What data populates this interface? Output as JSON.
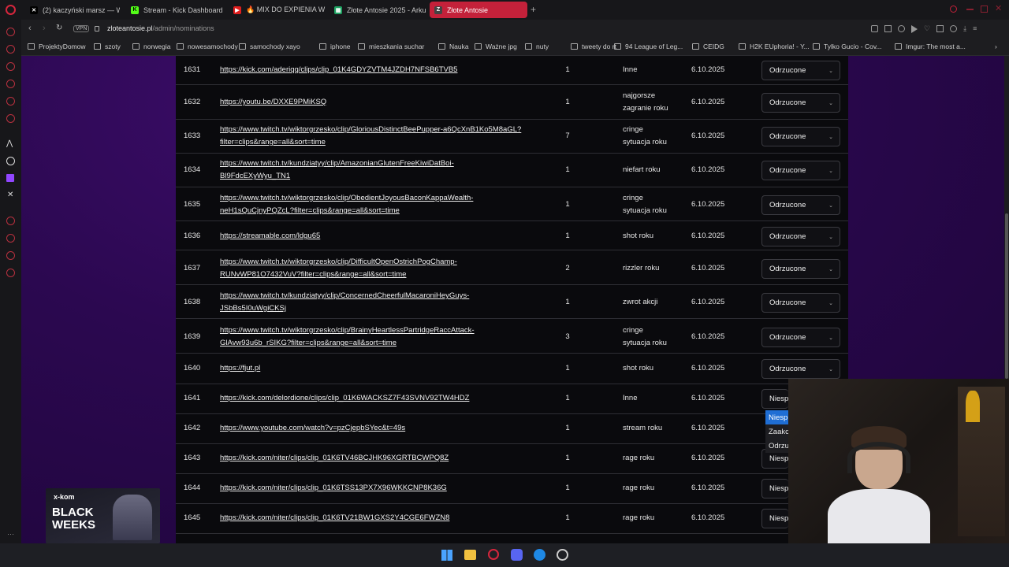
{
  "tabs": [
    {
      "icon": "x-icon",
      "label": "(2) kaczyński marsz — W"
    },
    {
      "icon": "kick-icon",
      "label": "Stream - Kick Dashboard"
    },
    {
      "icon": "youtube-icon",
      "label": "🔥 MIX DO EXPIENIA W"
    },
    {
      "icon": "sheets-icon",
      "label": "Złote Antosie 2025 - Arku"
    },
    {
      "icon": "site-icon",
      "label": "Złote Antosie"
    }
  ],
  "address": {
    "domain": "zloteantosie.pl",
    "path": "/admin/nominations",
    "vpn_label": "VPN"
  },
  "bookmarks": [
    "ProjektyDomow",
    "szoty",
    "norwegia",
    "nowesamochody",
    "samochody xayo",
    "iphone",
    "mieszkania suchar",
    "Nauka",
    "Ważne jpg",
    "nuty",
    "tweety do rt",
    "94 League of Leg...",
    "CEIDG",
    "H2K EUphoria! - Y...",
    "Tylko Gucio - Cov...",
    "Imgur: The most a..."
  ],
  "rows": [
    {
      "id": "1631",
      "url": [
        "https://kick.com/aderiqq/clips/clip_01K4GDYZVTM4JZDH7NFSB6TVB5"
      ],
      "votes": "1",
      "category": [
        "Inne"
      ],
      "date": "6.10.2025",
      "status": "Odrzucone"
    },
    {
      "id": "1632",
      "url": [
        "https://youtu.be/DXXE9PMiKSQ"
      ],
      "votes": "1",
      "category": [
        "najgorsze",
        "zagranie roku"
      ],
      "date": "6.10.2025",
      "status": "Odrzucone"
    },
    {
      "id": "1633",
      "url": [
        "https://www.twitch.tv/wiktorgrzesko/clip/GloriousDistinctBeePupper-a6QcXnB1Ko5M8aGL?",
        "filter=clips&range=all&sort=time"
      ],
      "votes": "7",
      "category": [
        "cringe",
        "sytuacja roku"
      ],
      "date": "6.10.2025",
      "status": "Odrzucone"
    },
    {
      "id": "1634",
      "url": [
        "https://www.twitch.tv/kundziatyy/clip/AmazonianGlutenFreeKiwiDatBoi-",
        "Bl9FdcEXyWyu_TN1"
      ],
      "votes": "1",
      "category": [
        "niefart roku"
      ],
      "date": "6.10.2025",
      "status": "Odrzucone"
    },
    {
      "id": "1635",
      "url": [
        "https://www.twitch.tv/wiktorgrzesko/clip/ObedientJoyousBaconKappaWealth-",
        "neH1sQuCjnyPQZcL?filter=clips&range=all&sort=time"
      ],
      "votes": "1",
      "category": [
        "cringe",
        "sytuacja roku"
      ],
      "date": "6.10.2025",
      "status": "Odrzucone"
    },
    {
      "id": "1636",
      "url": [
        "https://streamable.com/ldgu65"
      ],
      "votes": "1",
      "category": [
        "shot roku"
      ],
      "date": "6.10.2025",
      "status": "Odrzucone"
    },
    {
      "id": "1637",
      "url": [
        "https://www.twitch.tv/wiktorgrzesko/clip/DifficultOpenOstrichPogChamp-",
        "RUNvWP81O7432VuV?filter=clips&range=all&sort=time"
      ],
      "votes": "2",
      "category": [
        "rizzler roku"
      ],
      "date": "6.10.2025",
      "status": "Odrzucone"
    },
    {
      "id": "1638",
      "url": [
        "https://www.twitch.tv/kundziatyy/clip/ConcernedCheerfulMacaroniHeyGuys-",
        "JSbBs5I0uWgiCKSj"
      ],
      "votes": "1",
      "category": [
        "zwrot akcji"
      ],
      "date": "6.10.2025",
      "status": "Odrzucone"
    },
    {
      "id": "1639",
      "url": [
        "https://www.twitch.tv/wiktorgrzesko/clip/BrainyHeartlessPartridgeRaccAttack-",
        "GlAvw93u6b_rSIKG?filter=clips&range=all&sort=time"
      ],
      "votes": "3",
      "category": [
        "cringe",
        "sytuacja roku"
      ],
      "date": "6.10.2025",
      "status": "Odrzucone"
    },
    {
      "id": "1640",
      "url": [
        "https://fjut.pl"
      ],
      "votes": "1",
      "category": [
        "shot roku"
      ],
      "date": "6.10.2025",
      "status": "Odrzucone"
    },
    {
      "id": "1641",
      "url": [
        "https://kick.com/delordione/clips/clip_01K6WACKSZ7F43SVNV92TW4HDZ"
      ],
      "votes": "1",
      "category": [
        "Inne"
      ],
      "date": "6.10.2025",
      "status": "Niesp"
    },
    {
      "id": "1642",
      "url": [
        "https://www.youtube.com/watch?v=pzCjepbSYec&t=49s"
      ],
      "votes": "1",
      "category": [
        "stream roku"
      ],
      "date": "6.10.2025",
      "status": ""
    },
    {
      "id": "1643",
      "url": [
        "https://kick.com/niter/clips/clip_01K6TV46BCJHK96XGRTBCWPQ8Z"
      ],
      "votes": "1",
      "category": [
        "rage roku"
      ],
      "date": "6.10.2025",
      "status": "Niesp"
    },
    {
      "id": "1644",
      "url": [
        "https://kick.com/niter/clips/clip_01K6TSS13PX7X96WKKCNP8K36G"
      ],
      "votes": "1",
      "category": [
        "rage roku"
      ],
      "date": "6.10.2025",
      "status": "Niesp"
    },
    {
      "id": "1645",
      "url": [
        "https://kick.com/niter/clips/clip_01K6TV21BW1GXS2Y4CGE6FWZN8"
      ],
      "votes": "1",
      "category": [
        "rage roku"
      ],
      "date": "6.10.2025",
      "status": "Niesp"
    }
  ],
  "dropdown_options": [
    "Niesp",
    "Zaakc",
    "Odrzu"
  ],
  "ad": {
    "brand": "x-kom",
    "headline_1": "BLACK",
    "headline_2": "WEEKS"
  },
  "colors": {
    "accent": "#c4213a",
    "page_bg": "#2b0850",
    "selected_option": "#1f6ed4"
  }
}
